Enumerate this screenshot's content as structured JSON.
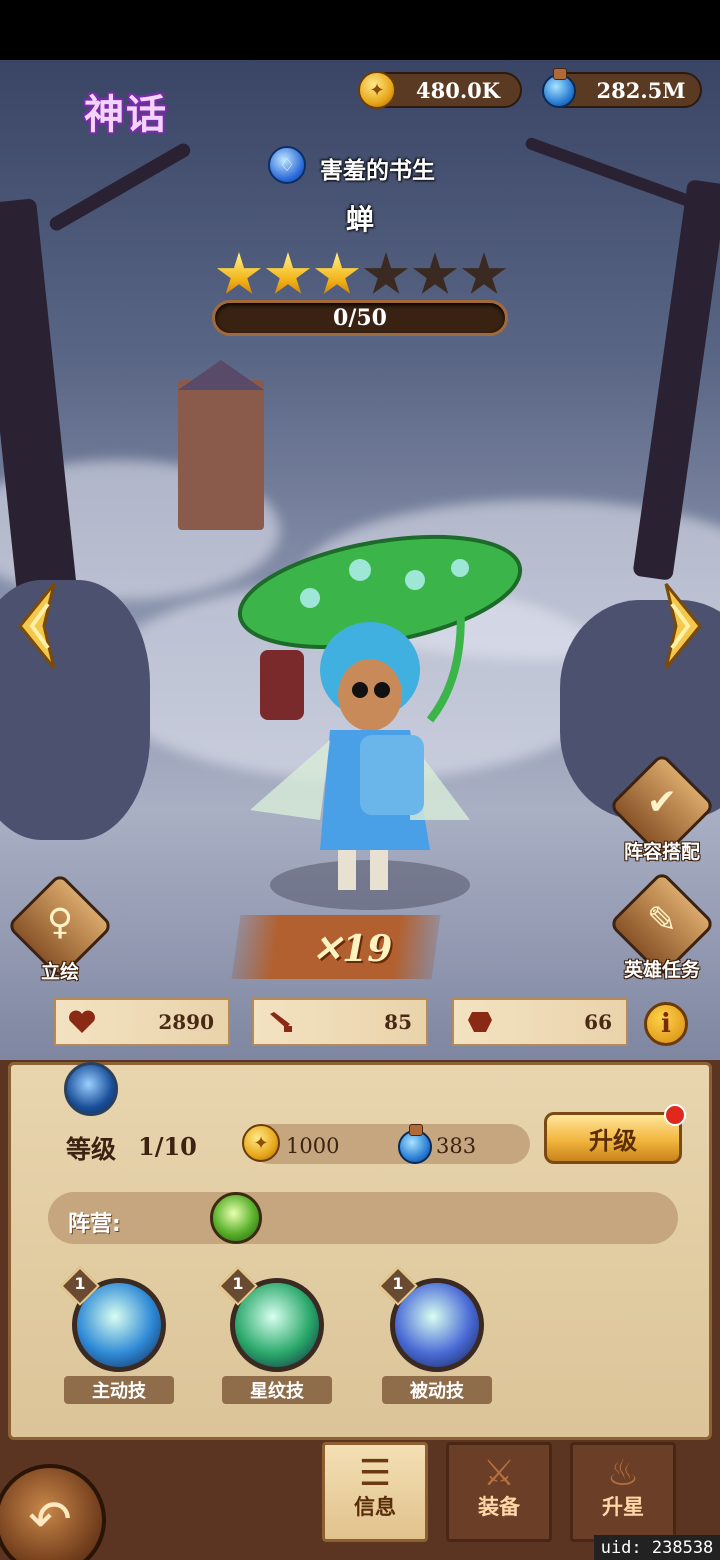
{
  "header": {
    "rarity": "神话",
    "gold": "480.0K",
    "potion": "282.5M"
  },
  "hero": {
    "title": "害羞的书生",
    "name": "蝉",
    "stars_total": 6,
    "stars_filled": 3,
    "progress_text": "0/50",
    "progress_fraction": 0,
    "level_banner": "19"
  },
  "side_buttons": {
    "portrait": "立绘",
    "lineup": "阵容搭配",
    "quest": "英雄任务"
  },
  "stats": {
    "hp": "2890",
    "attack": "85",
    "defense": "66",
    "info_icon": "i"
  },
  "panel": {
    "level_label": "等级",
    "level_value": "1/10",
    "gold_cost": "1000",
    "potion_cost": "383",
    "upgrade_label": "升级",
    "faction_label": "阵营:"
  },
  "skills": [
    {
      "name": "主动技",
      "level": "1",
      "color": "#2f8ad6"
    },
    {
      "name": "星纹技",
      "level": "1",
      "color": "#2aa86a"
    },
    {
      "name": "被动技",
      "level": "1",
      "color": "#4a6ad6"
    }
  ],
  "tabs": [
    {
      "label": "信息",
      "icon": "scroll-icon",
      "active": true
    },
    {
      "label": "装备",
      "icon": "sword-icon",
      "active": false
    },
    {
      "label": "升星",
      "icon": "flame-icon",
      "active": false
    }
  ],
  "footer": {
    "uid": "uid: 238538"
  },
  "colors": {
    "accent_gold": "#f2b63f",
    "panel_parchment": "#e8d5ae",
    "notification_red": "#e0281c"
  }
}
